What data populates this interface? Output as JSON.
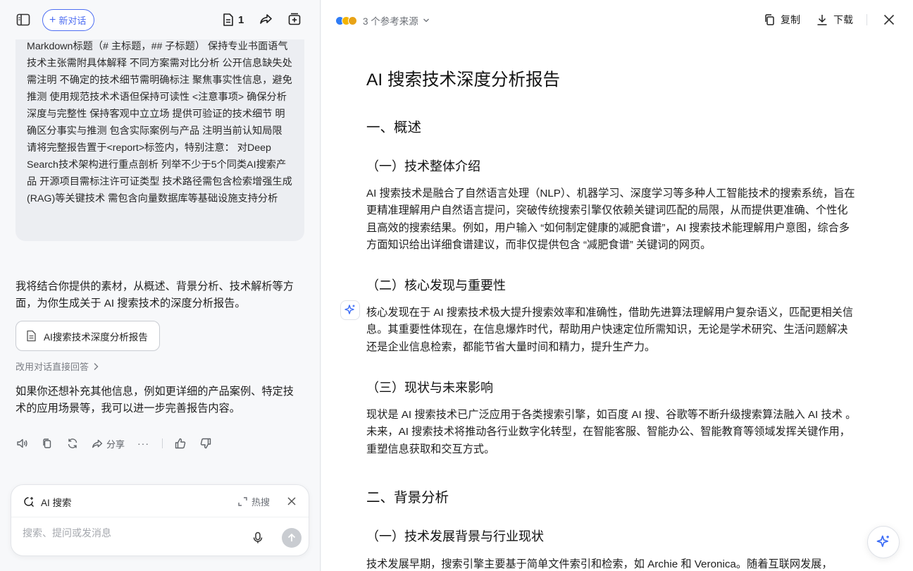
{
  "left": {
    "header": {
      "new_chat_label": "新对话",
      "doc_count": "1"
    },
    "user_message": {
      "text": "展方向 现存挑战与限制 未来研究重点 <格式要求> 使用Markdown标题（# 主标题，## 子标题） 保持专业书面语气 技术主张需附具体解释 不同方案需对比分析 公开信息缺失处需注明 不确定的技术细节需明确标注 聚焦事实性信息，避免推测 使用规范技术术语但保持可读性 <注意事项> 确保分析深度与完整性 保持客观中立立场 提供可验证的技术细节 明确区分事实与推测 包含实际案例与产品 注明当前认知局限 请将完整报告置于<report>标签内，特别注意： 对Deep Search技术架构进行重点剖析 列举不少于5个同类AI搜索产品 开源项目需标注许可证类型 技术路径需包含检索增强生成(RAG)等关键技术 需包含向量数据库等基础设施支持分析"
    },
    "assistant": {
      "reply_text": "我将结合你提供的素材，从概述、背景分析、技术解析等方面，为你生成关于 AI 搜索技术的深度分析报告。",
      "report_card_label": "AI搜索技术深度分析报告",
      "switch_link": "改用对话直接回答",
      "follow_up_text": "如果你还想补充其他信息，例如更详细的产品案例、特定技术的应用场景等，我可以进一步完善报告内容。",
      "share_label": "分享",
      "more_label": "···"
    },
    "composer": {
      "mode_label": "AI 搜索",
      "hot_label": "热搜",
      "placeholder": "搜索、提问或发消息"
    }
  },
  "right": {
    "header": {
      "sources_label": "3 个参考来源",
      "copy_label": "复制",
      "download_label": "下载",
      "source_colors": [
        "#2f7cf6",
        "#f5b400",
        "#e8a317"
      ]
    },
    "doc": {
      "title": "AI 搜索技术深度分析报告",
      "s1": "一、概述",
      "s1_1": "（一）技术整体介绍",
      "p1": "AI 搜索技术是融合了自然语言处理（NLP）、机器学习、深度学习等多种人工智能技术的搜索系统，旨在更精准理解用户自然语言提问，突破传统搜索引擎仅依赖关键词匹配的局限，从而提供更准确、个性化且高效的搜索结果。例如，用户输入 “如何制定健康的减肥食谱”，AI 搜索技术能理解用户意图，综合多方面知识给出详细食谱建议，而非仅提供包含 “减肥食谱” 关键词的网页。",
      "s1_2": "（二）核心发现与重要性",
      "p2": "核心发现在于 AI 搜索技术极大提升搜索效率和准确性，借助先进算法理解用户复杂语义，匹配更相关信息。其重要性体现在，在信息爆炸时代，帮助用户快速定位所需知识，无论是学术研究、生活问题解决还是企业信息检索，都能节省大量时间和精力，提升生产力。",
      "s1_3": "（三）现状与未来影响",
      "p3": "现状是 AI 搜索技术已广泛应用于各类搜索引擎，如百度 AI 搜、谷歌等不断升级搜索算法融入 AI 技术 。未来，AI 搜索技术将推动各行业数字化转型，在智能客服、智能办公、智能教育等领域发挥关键作用，重塑信息获取和交互方式。",
      "s2": "二、背景分析",
      "s2_1": "（一）技术发展背景与行业现状",
      "p4": "技术发展早期，搜索引擎主要基于简单文件索引和检索，如 Archie 和 Veronica。随着互联网发展，"
    }
  }
}
